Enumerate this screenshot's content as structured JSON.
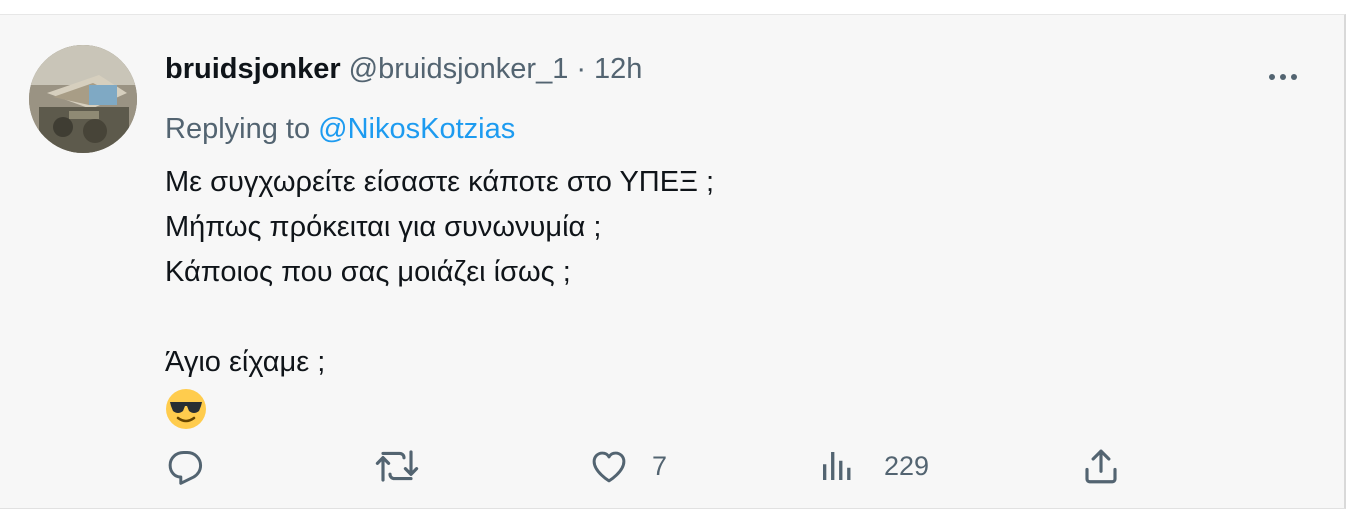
{
  "tweet": {
    "display_name": "bruidsjonker",
    "handle": "@bruidsjonker_1",
    "separator": "·",
    "time": "12h",
    "replying_prefix": "Replying to",
    "replying_to": "@NikosKotzias",
    "text_lines": [
      "Με συγχωρείτε είσαστε κάποτε στο ΥΠΕΞ ;",
      "Μήπως πρόκειται για συνωνυμία ;",
      "Κάποιος που σας μοιάζει ίσως ;",
      "",
      "Άγιο είχαμε ;"
    ],
    "emoji": "smiling-face-with-sunglasses"
  },
  "actions": {
    "reply_icon": "reply-icon",
    "retweet_icon": "retweet-icon",
    "like_icon": "like-icon",
    "like_count": "7",
    "views_icon": "views-icon",
    "views_count": "229",
    "share_icon": "share-icon"
  },
  "colors": {
    "text": "#0f1419",
    "secondary": "#536471",
    "accent": "#1d9bf0",
    "background": "#f7f7f7"
  }
}
